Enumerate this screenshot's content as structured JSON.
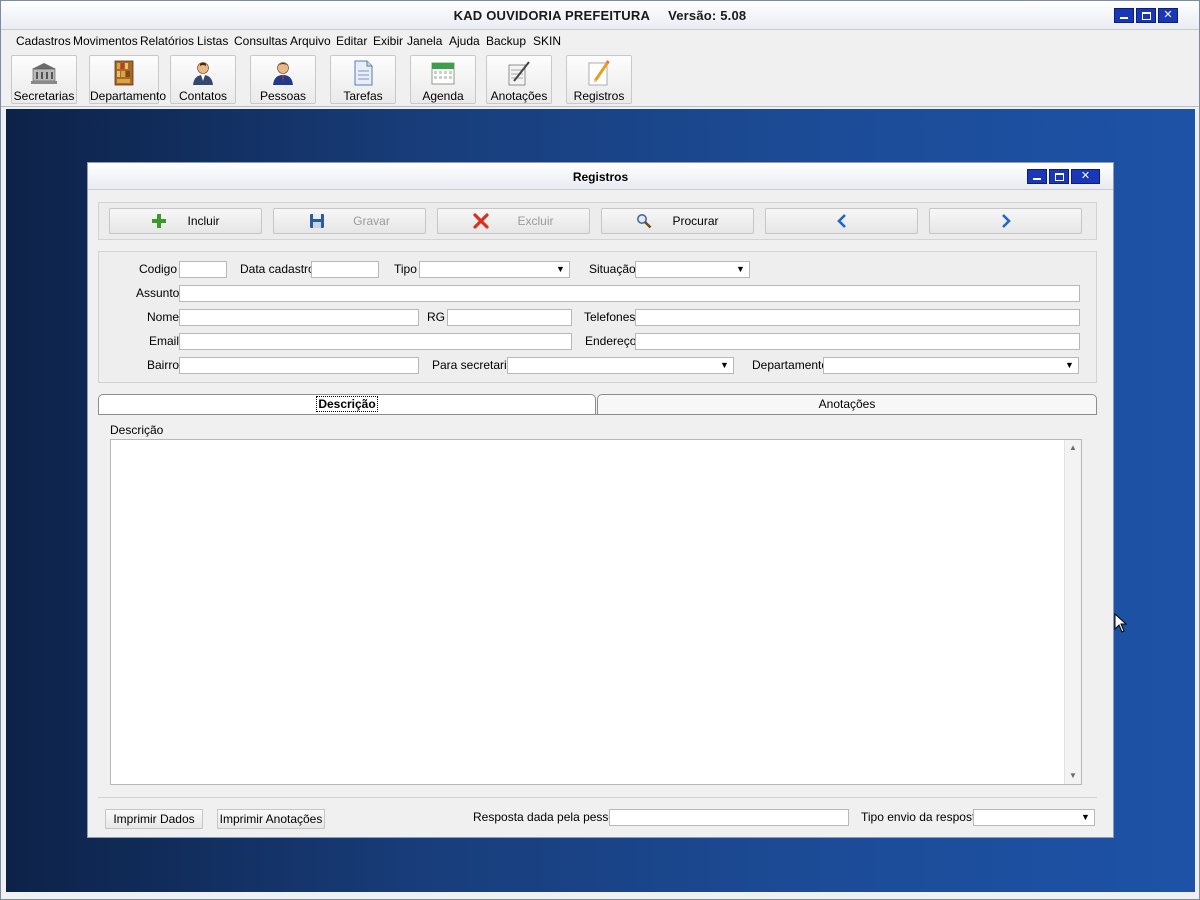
{
  "app": {
    "title": "KAD OUVIDORIA PREFEITURA",
    "version": "Versão: 5.08"
  },
  "menu": [
    "Cadastros",
    "Movimentos",
    "Relatórios",
    "Listas",
    "Consultas",
    "Arquivo",
    "Editar",
    "Exibir",
    "Janela",
    "Ajuda",
    "Backup",
    "SKIN"
  ],
  "toolbar": {
    "secretarias": "Secretarias",
    "departamento": "Departamento",
    "contatos": "Contatos",
    "pessoas": "Pessoas",
    "tarefas": "Tarefas",
    "agenda": "Agenda",
    "anotacoes": "Anotações",
    "registros": "Registros"
  },
  "child": {
    "title": "Registros",
    "actions": {
      "incluir": "Incluir",
      "gravar": "Gravar",
      "excluir": "Excluir",
      "procurar": "Procurar"
    },
    "form": {
      "codigo": "Codigo",
      "data_cadastro": "Data cadastro",
      "tipo": "Tipo",
      "situacao": "Situação",
      "assunto": "Assunto",
      "nome": "Nome",
      "rg": "RG",
      "telefones": "Telefones",
      "email": "Email",
      "endereco": "Endereço",
      "bairro": "Bairro",
      "para_secretaria": "Para secretaria",
      "departamento": "Departamento"
    },
    "tabs": {
      "descricao": "Descrição",
      "anotacoes": "Anotações"
    },
    "descricao_label": "Descrição",
    "bottom": {
      "imprimir_dados": "Imprimir Dados",
      "imprimir_anotacoes": "Imprimir Anotações",
      "resposta_label": "Resposta dada pela pessoa",
      "tipo_envio_label": "Tipo envio da resposta"
    }
  },
  "colors": {
    "window_button": "#1a37b8",
    "desktop_dark": "#0d2248",
    "desktop_light": "#1d52a6"
  }
}
